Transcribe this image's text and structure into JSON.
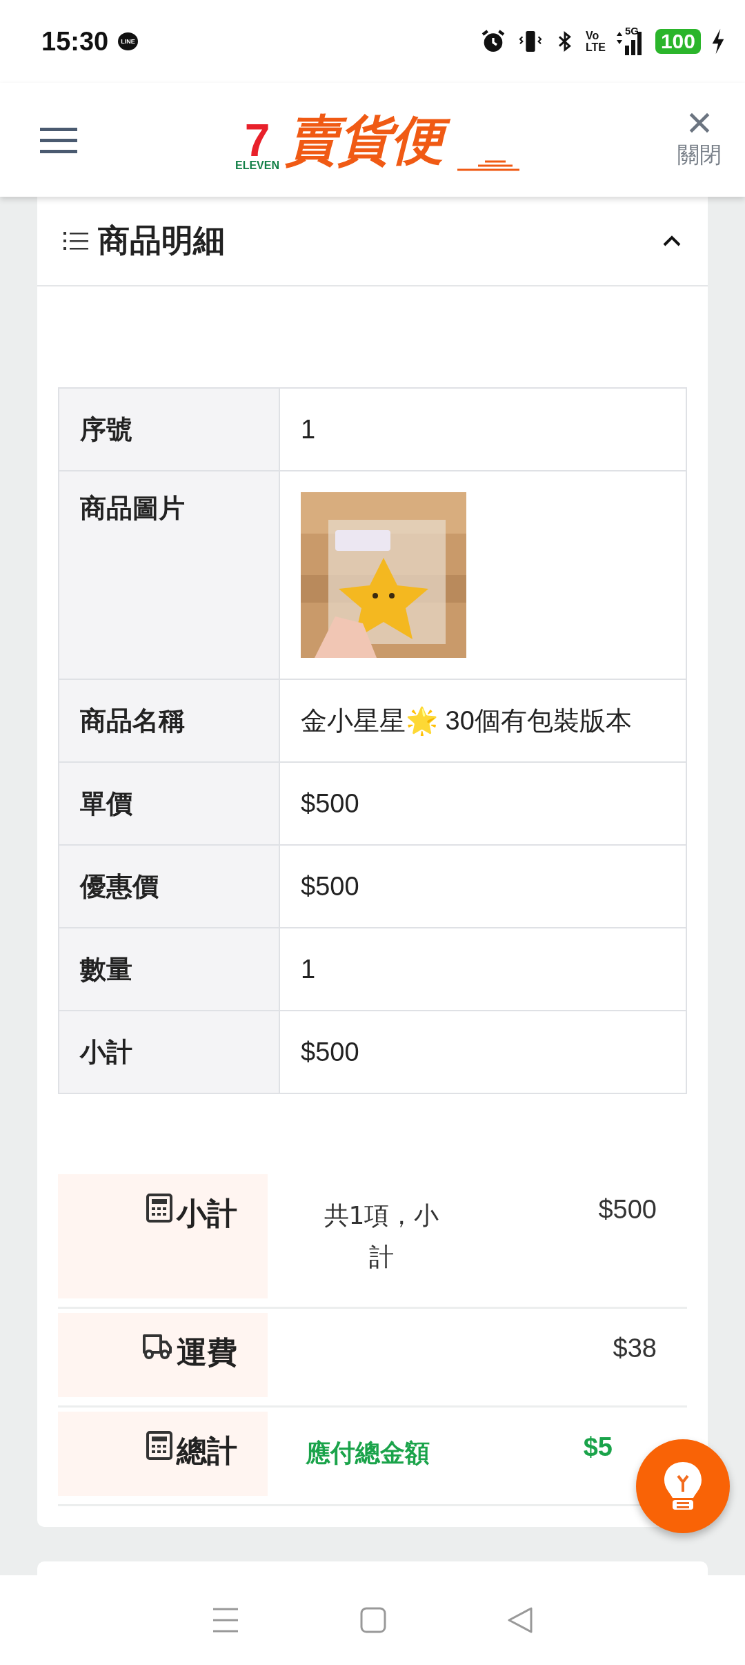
{
  "status_bar": {
    "time": "15:30",
    "app_badge": "LINE",
    "network_top": "Vo",
    "network_bottom": "LTE",
    "signal_label": "5G",
    "battery": "100"
  },
  "header": {
    "logo_number": "7",
    "logo_brand": "ELEVEN",
    "logo_title": "賣貨便",
    "close_label": "關閉"
  },
  "section": {
    "title": "商品明細",
    "expanded": true
  },
  "details": [
    {
      "kind": "text",
      "label": "序號",
      "value": "1"
    },
    {
      "kind": "picture",
      "label": "商品圖片"
    },
    {
      "kind": "text",
      "label": "商品名稱",
      "value": "金小星星🌟 30個有包裝版本"
    },
    {
      "kind": "text",
      "label": "單價",
      "value": "$500"
    },
    {
      "kind": "text",
      "label": "優惠價",
      "value": "$500"
    },
    {
      "kind": "text",
      "label": "數量",
      "value": "1"
    },
    {
      "kind": "text",
      "label": "小計",
      "value": "$500"
    }
  ],
  "summary": [
    {
      "kind": "calculator",
      "label": "小計",
      "note": "共1項，小計",
      "amount": "$500",
      "highlight": false
    },
    {
      "kind": "truck",
      "label": "運費",
      "amount": "$38",
      "highlight": false
    },
    {
      "kind": "calculator",
      "label": "總計",
      "note": "應付總金額",
      "amount": "$5",
      "highlight": true
    }
  ]
}
